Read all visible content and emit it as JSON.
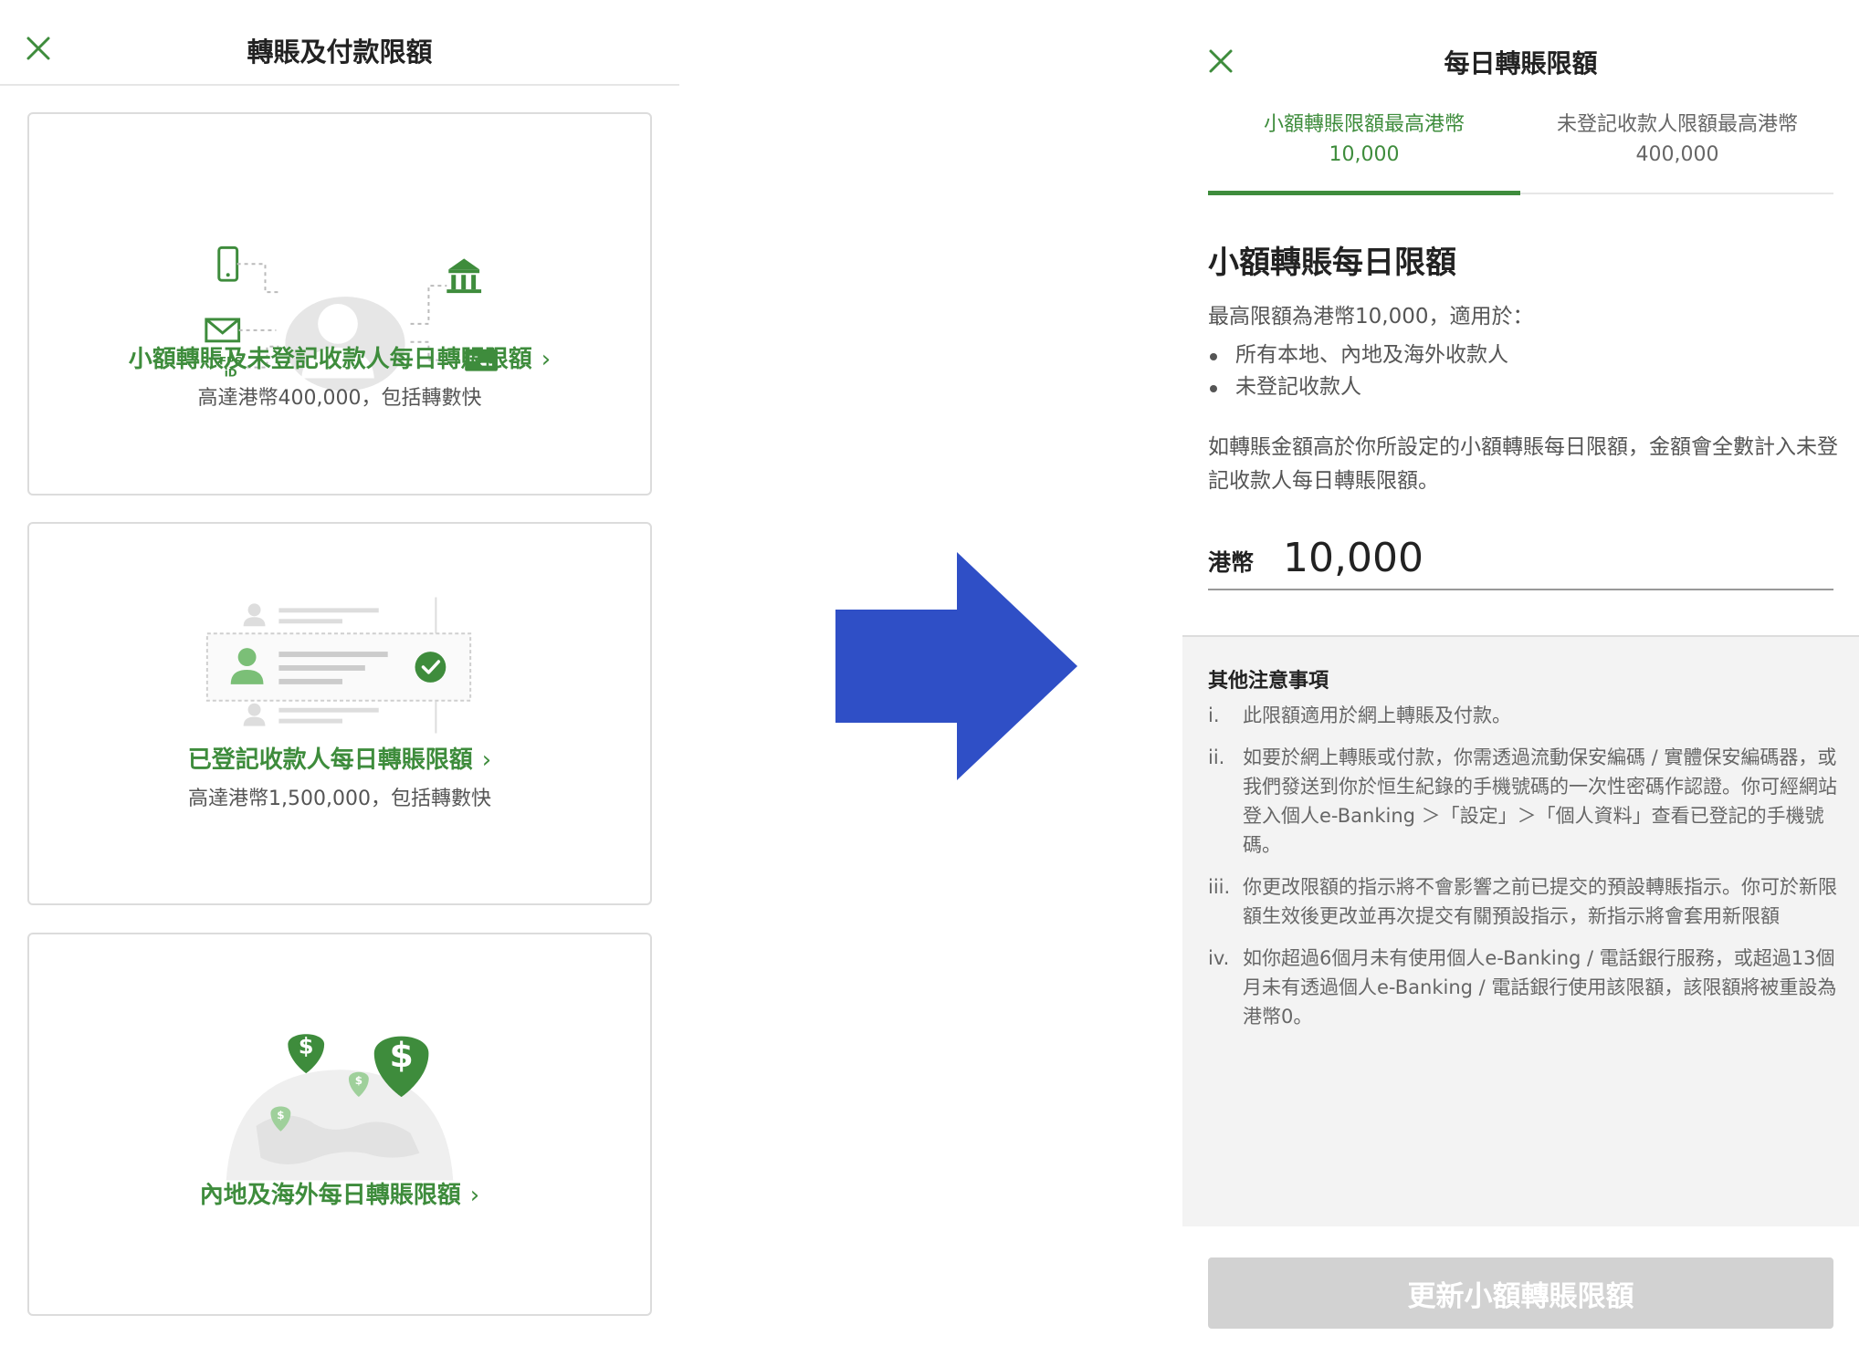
{
  "left": {
    "title": "轉賬及付款限額",
    "cards": [
      {
        "title": "小額轉賬及未登記收款人每日轉賬限額",
        "subtitle": "高達港幣400,000，包括轉數快"
      },
      {
        "title": "已登記收款人每日轉賬限額",
        "subtitle": "高達港幣1,500,000，包括轉數快"
      },
      {
        "title": "內地及海外每日轉賬限額",
        "subtitle": ""
      }
    ],
    "fps_label": [
      "FPS",
      "iD"
    ]
  },
  "right": {
    "title": "每日轉賬限額",
    "tabs": [
      {
        "line1": "小額轉賬限額最高港幣",
        "line2": "10,000",
        "active": true
      },
      {
        "line1": "未登記收款人限額最高港幣",
        "line2": "400,000",
        "active": false
      }
    ],
    "section_title": "小額轉賬每日限額",
    "intro": "最高限額為港幣10,000，適用於：",
    "bullets": [
      "所有本地、內地及海外收款人",
      "未登記收款人"
    ],
    "paragraph": "如轉賬金額高於你所設定的小額轉賬每日限額，金額會全數計入未登記收款人每日轉賬限額。",
    "amount": {
      "currency": "港幣",
      "value": "10,000"
    },
    "notes": {
      "title": "其他注意事項",
      "items": [
        {
          "num": "i.",
          "text": "此限額適用於網上轉賬及付款。"
        },
        {
          "num": "ii.",
          "text": "如要於網上轉賬或付款，你需透過流動保安編碼 / 實體保安編碼器，或我們發送到你於恒生紀錄的手機號碼的一次性密碼作認證。你可經網站登入個人e-Banking ＞「設定」＞「個人資料」查看已登記的手機號碼。"
        },
        {
          "num": "iii.",
          "text": "你更改限額的指示將不會影響之前已提交的預設轉賬指示。你可於新限額生效後更改並再次提交有關預設指示，新指示將會套用新限額"
        },
        {
          "num": "iv.",
          "text": "如你超過6個月未有使用個人e-Banking / 電話銀行服務，或超過13個月未有透過個人e-Banking / 電話銀行使用該限額，該限額將被重設為港幣0。"
        }
      ]
    },
    "button_label": "更新小額轉賬限額"
  },
  "icons": {
    "close": "close-icon",
    "chevron": "chevron-right-icon",
    "arrow": "right-arrow-icon"
  },
  "colors": {
    "brand_green": "#3e8c3c",
    "arrow_blue": "#2f4fc6",
    "disabled_button": "#d2d2d2"
  }
}
